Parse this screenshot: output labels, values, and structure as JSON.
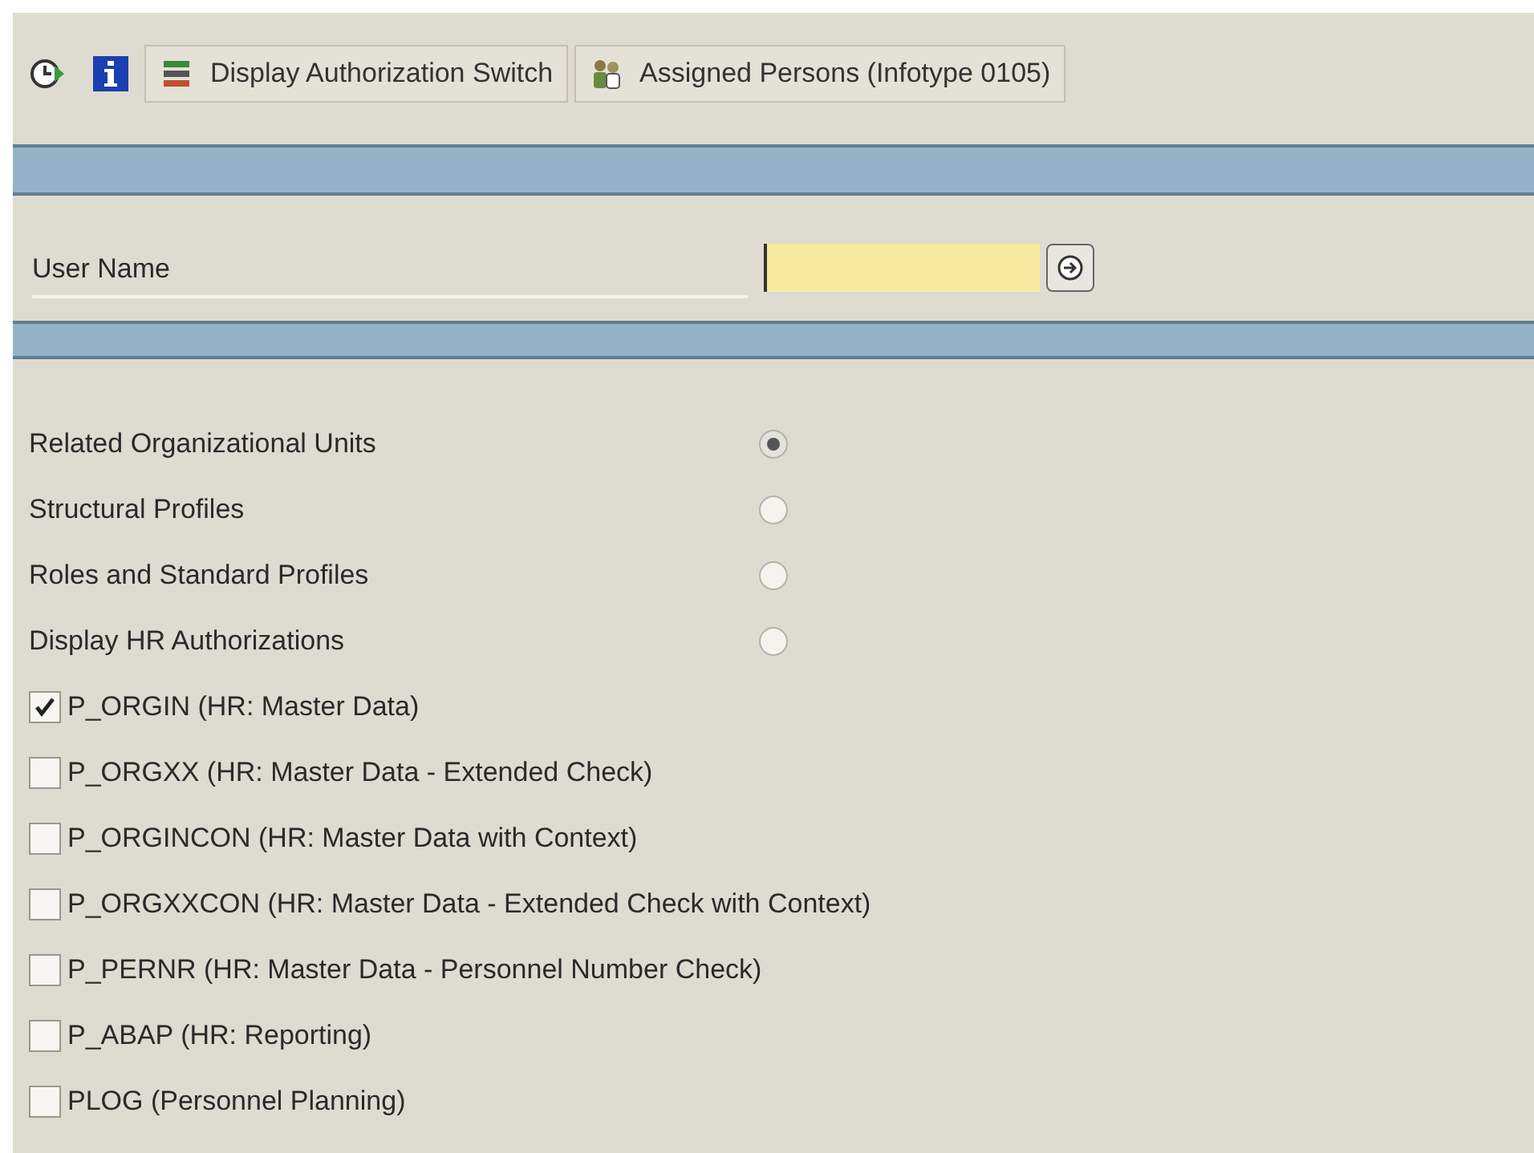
{
  "toolbar": {
    "buttons": [
      {
        "kind": "execute"
      },
      {
        "kind": "info"
      },
      {
        "kind": "switch",
        "label": "Display Authorization Switch"
      },
      {
        "kind": "persons",
        "label": "Assigned Persons (Infotype 0105)"
      }
    ]
  },
  "user_name": {
    "label": "User Name"
  },
  "options": [
    {
      "kind": "radio",
      "label": "Related Organizational Units",
      "selected": true
    },
    {
      "kind": "radio",
      "label": "Structural Profiles",
      "selected": false
    },
    {
      "kind": "radio",
      "label": "Roles and Standard Profiles",
      "selected": false
    },
    {
      "kind": "radio",
      "label": "Display HR Authorizations",
      "selected": false
    },
    {
      "kind": "checkbox",
      "label": "P_ORGIN (HR: Master Data)",
      "checked": true
    },
    {
      "kind": "checkbox",
      "label": "P_ORGXX (HR: Master Data - Extended Check)",
      "checked": false
    },
    {
      "kind": "checkbox",
      "label": "P_ORGINCON (HR: Master Data with Context)",
      "checked": false
    },
    {
      "kind": "checkbox",
      "label": "P_ORGXXCON (HR: Master Data - Extended Check with Context)",
      "checked": false
    },
    {
      "kind": "checkbox",
      "label": "P_PERNR (HR: Master Data - Personnel Number Check)",
      "checked": false
    },
    {
      "kind": "checkbox",
      "label": "P_ABAP (HR: Reporting)",
      "checked": false
    },
    {
      "kind": "checkbox",
      "label": "PLOG (Personnel Planning)",
      "checked": false
    }
  ]
}
